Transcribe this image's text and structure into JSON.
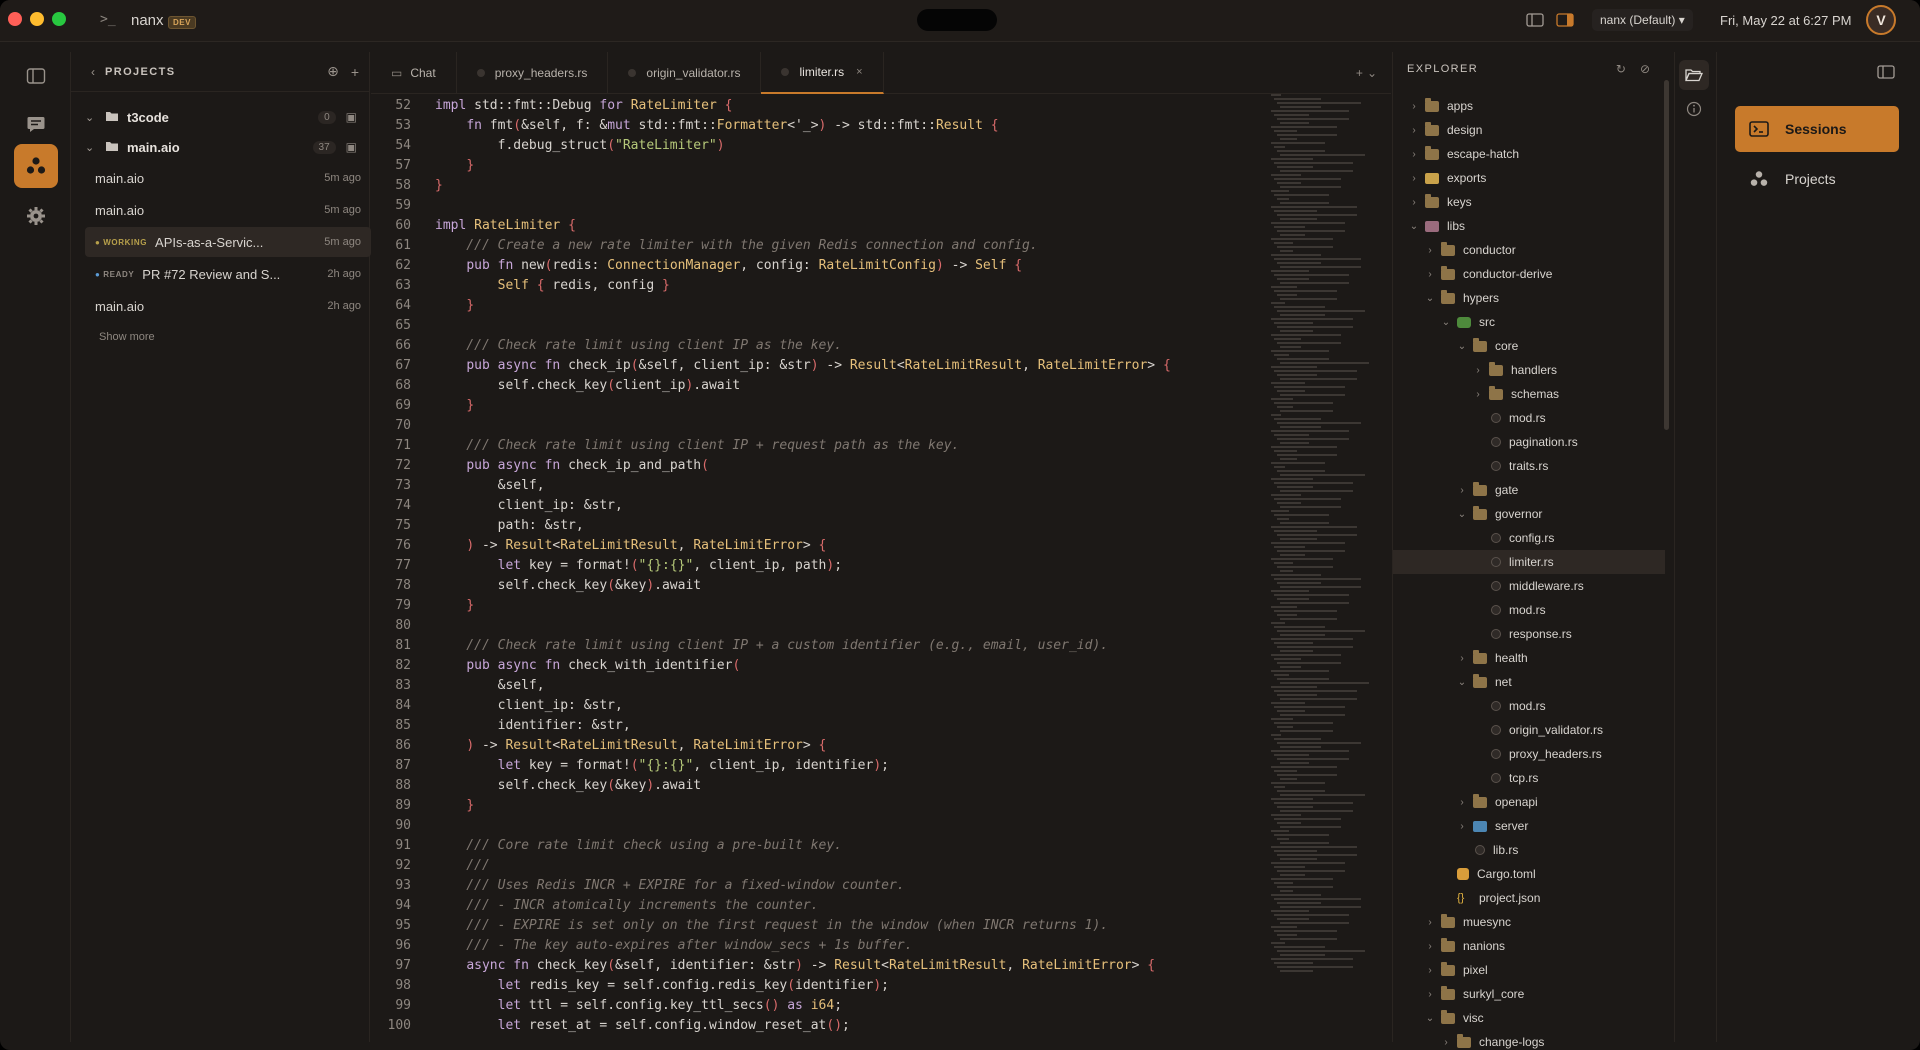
{
  "titlebar": {
    "prompt": ">_",
    "app_name": "nanx",
    "badge": "DEV",
    "workspace": "nanx (Default)",
    "datetime": "Fri, May 22 at 6:27 PM",
    "avatar_initial": "V"
  },
  "projects": {
    "title": "PROJECTS",
    "groups": [
      {
        "name": "t3code",
        "count": "0"
      },
      {
        "name": "main.aio",
        "count": "37"
      }
    ],
    "sessions": [
      {
        "status": "",
        "name": "main.aio",
        "time": "5m ago"
      },
      {
        "status": "",
        "name": "main.aio",
        "time": "5m ago"
      },
      {
        "status": "WORKING",
        "name": "APIs-as-a-Servic...",
        "time": "5m ago"
      },
      {
        "status": "READY",
        "name": "PR #72 Review and S...",
        "time": "2h ago"
      },
      {
        "status": "",
        "name": "main.aio",
        "time": "2h ago"
      }
    ],
    "show_more": "Show more"
  },
  "editor": {
    "tabs": [
      {
        "label": "Chat"
      },
      {
        "label": "proxy_headers.rs"
      },
      {
        "label": "origin_validator.rs"
      },
      {
        "label": "limiter.rs"
      }
    ],
    "tabs_action": "+",
    "lines": [
      {
        "n": "52",
        "t": "impl std::fmt::Debug for RateLimiter {"
      },
      {
        "n": "53",
        "t": "    fn fmt(&self, f: &mut std::fmt::Formatter<'_>) -> std::fmt::Result {"
      },
      {
        "n": "54",
        "t": "        f.debug_struct(\"RateLimiter\")"
      },
      {
        "n": "57",
        "t": "    }"
      },
      {
        "n": "58",
        "t": "}"
      },
      {
        "n": "59",
        "t": ""
      },
      {
        "n": "60",
        "t": "impl RateLimiter {"
      },
      {
        "n": "61",
        "t": "    /// Create a new rate limiter with the given Redis connection and config."
      },
      {
        "n": "62",
        "t": "    pub fn new(redis: ConnectionManager, config: RateLimitConfig) -> Self {"
      },
      {
        "n": "63",
        "t": "        Self { redis, config }"
      },
      {
        "n": "64",
        "t": "    }"
      },
      {
        "n": "65",
        "t": ""
      },
      {
        "n": "66",
        "t": "    /// Check rate limit using client IP as the key."
      },
      {
        "n": "67",
        "t": "    pub async fn check_ip(&self, client_ip: &str) -> Result<RateLimitResult, RateLimitError> {"
      },
      {
        "n": "68",
        "t": "        self.check_key(client_ip).await"
      },
      {
        "n": "69",
        "t": "    }"
      },
      {
        "n": "70",
        "t": ""
      },
      {
        "n": "71",
        "t": "    /// Check rate limit using client IP + request path as the key."
      },
      {
        "n": "72",
        "t": "    pub async fn check_ip_and_path("
      },
      {
        "n": "73",
        "t": "        &self,"
      },
      {
        "n": "74",
        "t": "        client_ip: &str,"
      },
      {
        "n": "75",
        "t": "        path: &str,"
      },
      {
        "n": "76",
        "t": "    ) -> Result<RateLimitResult, RateLimitError> {"
      },
      {
        "n": "77",
        "t": "        let key = format!(\"{}:{}\", client_ip, path);"
      },
      {
        "n": "78",
        "t": "        self.check_key(&key).await"
      },
      {
        "n": "79",
        "t": "    }"
      },
      {
        "n": "80",
        "t": ""
      },
      {
        "n": "81",
        "t": "    /// Check rate limit using client IP + a custom identifier (e.g., email, user_id)."
      },
      {
        "n": "82",
        "t": "    pub async fn check_with_identifier("
      },
      {
        "n": "83",
        "t": "        &self,"
      },
      {
        "n": "84",
        "t": "        client_ip: &str,"
      },
      {
        "n": "85",
        "t": "        identifier: &str,"
      },
      {
        "n": "86",
        "t": "    ) -> Result<RateLimitResult, RateLimitError> {"
      },
      {
        "n": "87",
        "t": "        let key = format!(\"{}:{}\", client_ip, identifier);"
      },
      {
        "n": "88",
        "t": "        self.check_key(&key).await"
      },
      {
        "n": "89",
        "t": "    }"
      },
      {
        "n": "90",
        "t": ""
      },
      {
        "n": "91",
        "t": "    /// Core rate limit check using a pre-built key."
      },
      {
        "n": "92",
        "t": "    ///"
      },
      {
        "n": "93",
        "t": "    /// Uses Redis INCR + EXPIRE for a fixed-window counter."
      },
      {
        "n": "94",
        "t": "    /// - INCR atomically increments the counter."
      },
      {
        "n": "95",
        "t": "    /// - EXPIRE is set only on the first request in the window (when INCR returns 1)."
      },
      {
        "n": "96",
        "t": "    /// - The key auto-expires after window_secs + 1s buffer."
      },
      {
        "n": "97",
        "t": "    async fn check_key(&self, identifier: &str) -> Result<RateLimitResult, RateLimitError> {"
      },
      {
        "n": "98",
        "t": "        let redis_key = self.config.redis_key(identifier);"
      },
      {
        "n": "99",
        "t": "        let ttl = self.config.key_ttl_secs() as i64;"
      },
      {
        "n": "100",
        "t": "        let reset_at = self.config.window_reset_at();"
      }
    ]
  },
  "explorer": {
    "title": "EXPLORER",
    "rows": [
      {
        "depth": 0,
        "chev": "›",
        "icon": "folder",
        "name": "apps"
      },
      {
        "depth": 0,
        "chev": "›",
        "icon": "folder",
        "name": "design"
      },
      {
        "depth": 0,
        "chev": "›",
        "icon": "folder",
        "name": "escape-hatch"
      },
      {
        "depth": 0,
        "chev": "›",
        "icon": "exports",
        "name": "exports"
      },
      {
        "depth": 0,
        "chev": "›",
        "icon": "folder",
        "name": "keys"
      },
      {
        "depth": 0,
        "chev": "⌄",
        "icon": "libs",
        "name": "libs"
      },
      {
        "depth": 1,
        "chev": "›",
        "icon": "folder",
        "name": "conductor"
      },
      {
        "depth": 1,
        "chev": "›",
        "icon": "folder",
        "name": "conductor-derive"
      },
      {
        "depth": 1,
        "chev": "⌄",
        "icon": "folder",
        "name": "hypers"
      },
      {
        "depth": 2,
        "chev": "⌄",
        "icon": "special",
        "name": "src"
      },
      {
        "depth": 3,
        "chev": "⌄",
        "icon": "folder",
        "name": "core"
      },
      {
        "depth": 4,
        "chev": "›",
        "icon": "folder",
        "name": "handlers"
      },
      {
        "depth": 4,
        "chev": "›",
        "icon": "folder",
        "name": "schemas"
      },
      {
        "depth": 4,
        "chev": "",
        "icon": "rust",
        "name": "mod.rs"
      },
      {
        "depth": 4,
        "chev": "",
        "icon": "rust",
        "name": "pagination.rs"
      },
      {
        "depth": 4,
        "chev": "",
        "icon": "rust",
        "name": "traits.rs"
      },
      {
        "depth": 3,
        "chev": "›",
        "icon": "folder",
        "name": "gate"
      },
      {
        "depth": 3,
        "chev": "⌄",
        "icon": "folder",
        "name": "governor"
      },
      {
        "depth": 4,
        "chev": "",
        "icon": "rust",
        "name": "config.rs"
      },
      {
        "depth": 4,
        "chev": "",
        "icon": "rust",
        "name": "limiter.rs",
        "selected": true
      },
      {
        "depth": 4,
        "chev": "",
        "icon": "rust",
        "name": "middleware.rs"
      },
      {
        "depth": 4,
        "chev": "",
        "icon": "rust",
        "name": "mod.rs"
      },
      {
        "depth": 4,
        "chev": "",
        "icon": "rust",
        "name": "response.rs"
      },
      {
        "depth": 3,
        "chev": "›",
        "icon": "folder",
        "name": "health"
      },
      {
        "depth": 3,
        "chev": "⌄",
        "icon": "folder",
        "name": "net"
      },
      {
        "depth": 4,
        "chev": "",
        "icon": "rust",
        "name": "mod.rs"
      },
      {
        "depth": 4,
        "chev": "",
        "icon": "rust",
        "name": "origin_validator.rs"
      },
      {
        "depth": 4,
        "chev": "",
        "icon": "rust",
        "name": "proxy_headers.rs"
      },
      {
        "depth": 4,
        "chev": "",
        "icon": "rust",
        "name": "tcp.rs"
      },
      {
        "depth": 3,
        "chev": "›",
        "icon": "folder",
        "name": "openapi"
      },
      {
        "depth": 3,
        "chev": "›",
        "icon": "server",
        "name": "server"
      },
      {
        "depth": 3,
        "chev": "",
        "icon": "rust",
        "name": "lib.rs"
      },
      {
        "depth": 2,
        "chev": "",
        "icon": "toml",
        "name": "Cargo.toml"
      },
      {
        "depth": 2,
        "chev": "",
        "icon": "json",
        "name": "project.json"
      },
      {
        "depth": 1,
        "chev": "›",
        "icon": "folder",
        "name": "muesync"
      },
      {
        "depth": 1,
        "chev": "›",
        "icon": "folder",
        "name": "nanions"
      },
      {
        "depth": 1,
        "chev": "›",
        "icon": "folder",
        "name": "pixel"
      },
      {
        "depth": 1,
        "chev": "›",
        "icon": "folder",
        "name": "surkyl_core"
      },
      {
        "depth": 1,
        "chev": "⌄",
        "icon": "folder",
        "name": "visc"
      },
      {
        "depth": 2,
        "chev": "›",
        "icon": "folder",
        "name": "change-logs"
      }
    ]
  },
  "sessions_panel": {
    "items": [
      {
        "label": "Sessions"
      },
      {
        "label": "Projects"
      }
    ]
  },
  "colors": {
    "accent": "#c87a2b",
    "background": "#1c1917",
    "selected": "#2e2824"
  }
}
